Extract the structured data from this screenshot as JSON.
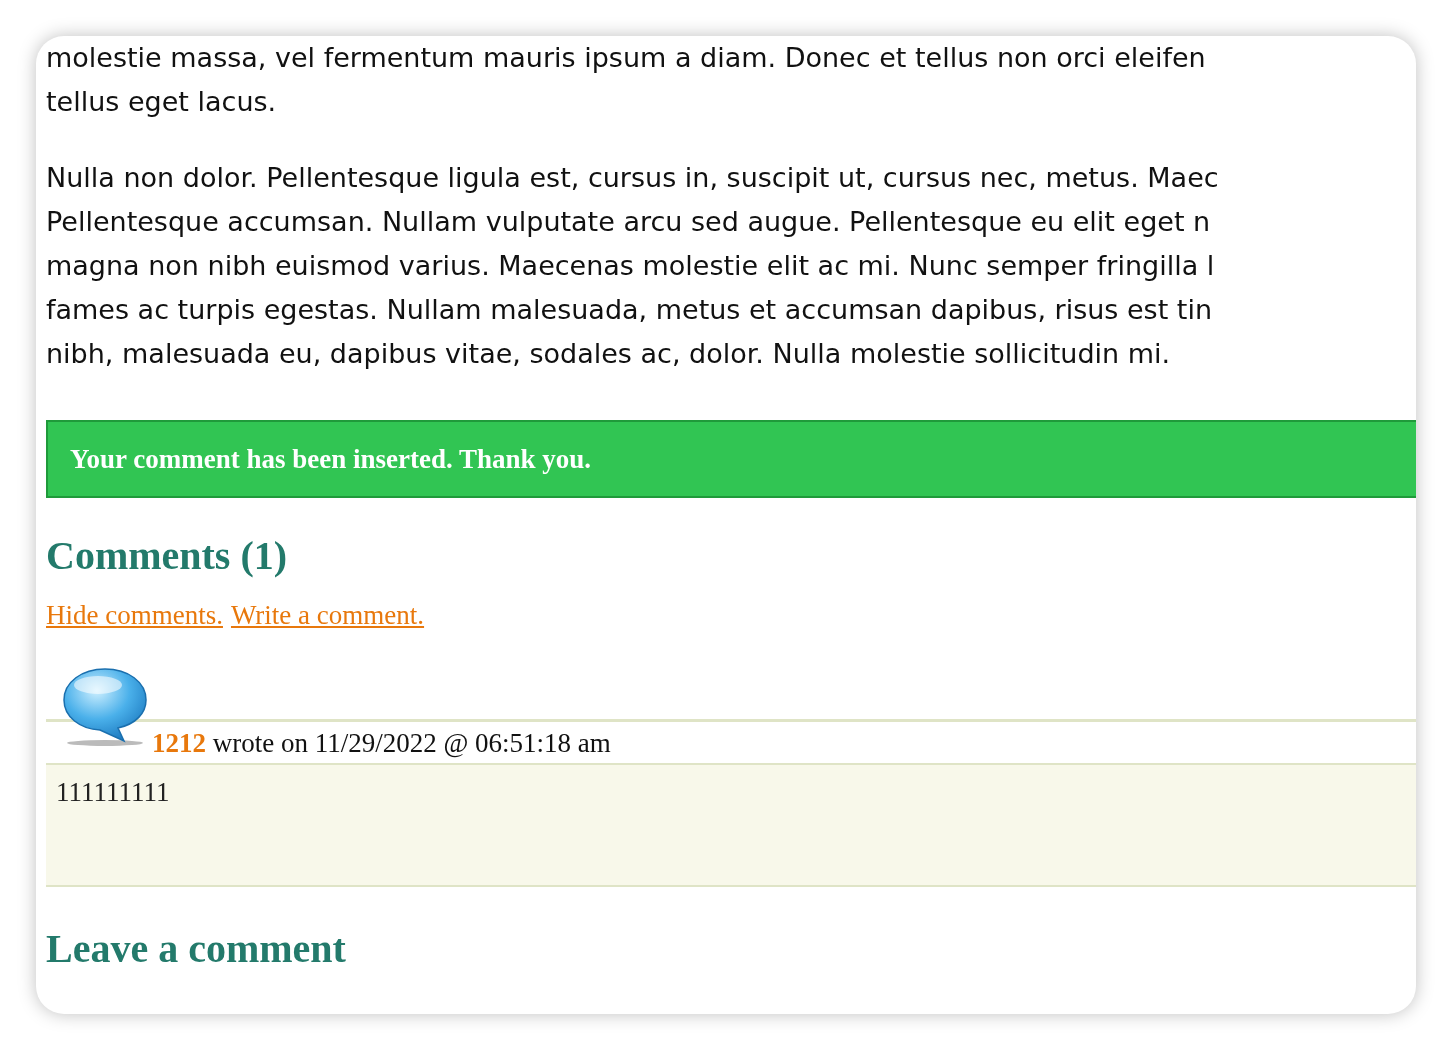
{
  "article": {
    "paragraphs": [
      {
        "lines": [
          "molestie massa, vel fermentum mauris ipsum a diam. Donec et tellus non orci eleifen",
          "tellus eget lacus."
        ]
      },
      {
        "lines": [
          "Nulla non dolor. Pellentesque ligula est, cursus in, suscipit ut, cursus nec, metus. Maec",
          "Pellentesque accumsan. Nullam vulputate arcu sed augue. Pellentesque eu elit eget n",
          "magna non nibh euismod varius. Maecenas molestie elit ac mi. Nunc semper fringilla l",
          "fames ac turpis egestas. Nullam malesuada, metus et accumsan dapibus, risus est tin",
          "nibh, malesuada eu, dapibus vitae, sodales ac, dolor. Nulla molestie sollicitudin mi."
        ]
      }
    ]
  },
  "notice": {
    "text": "Your comment has been inserted. Thank you."
  },
  "comments": {
    "heading": "Comments (1)",
    "links": [
      "Hide comments.",
      "Write a comment."
    ],
    "items": [
      {
        "author": "1212",
        "meta": "wrote on 11/29/2022 @ 06:51:18 am",
        "body": "111111111"
      }
    ]
  },
  "leave_comment": {
    "heading": "Leave a comment"
  }
}
